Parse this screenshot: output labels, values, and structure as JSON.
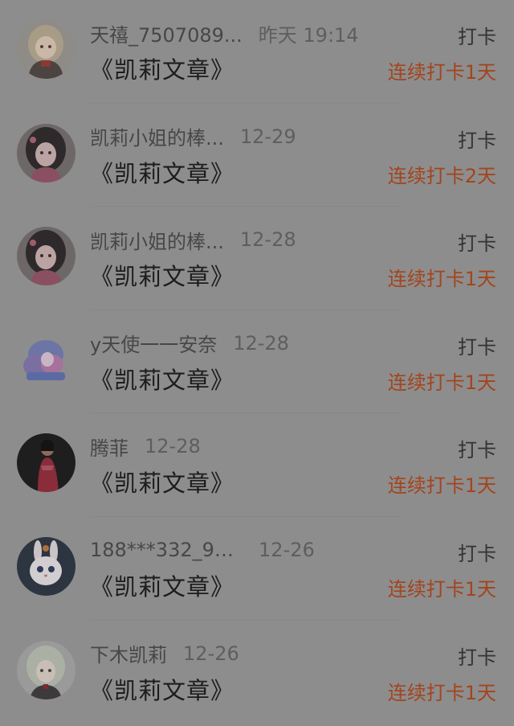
{
  "colors": {
    "overlay_background": "#8d8d8d",
    "streak_text": "#a3441d",
    "primary_text": "#1c1c1c",
    "secondary_text": "#474747"
  },
  "feed": {
    "items": [
      {
        "name": "天禧_7507089...",
        "time": "昨天 19:14",
        "post": "《凯莉文章》",
        "action": "打卡",
        "streak": "连续打卡1天",
        "avatar_icon": "anime-girl-cream-hair-avatar"
      },
      {
        "name": "凯莉小姐的棒...",
        "time": "12-29",
        "post": "《凯莉文章》",
        "action": "打卡",
        "streak": "连续打卡2天",
        "avatar_icon": "anime-girl-dark-hair-avatar"
      },
      {
        "name": "凯莉小姐的棒...",
        "time": "12-28",
        "post": "《凯莉文章》",
        "action": "打卡",
        "streak": "连续打卡1天",
        "avatar_icon": "anime-girl-dark-hair-avatar"
      },
      {
        "name": "y天使一一安奈",
        "time": "12-28",
        "post": "《凯莉文章》",
        "action": "打卡",
        "streak": "连续打卡1天",
        "avatar_icon": "anime-blue-hair-avatar"
      },
      {
        "name": "腾菲",
        "time": "12-28",
        "post": "《凯莉文章》",
        "action": "打卡",
        "streak": "连续打卡1天",
        "avatar_icon": "woman-red-dress-photo-avatar"
      },
      {
        "name": "188***332_92...",
        "time": "12-26",
        "post": "《凯莉文章》",
        "action": "打卡",
        "streak": "连续打卡1天",
        "avatar_icon": "white-rabbit-avatar"
      },
      {
        "name": "下木凯莉",
        "time": "12-26",
        "post": "《凯莉文章》",
        "action": "打卡",
        "streak": "连续打卡1天",
        "avatar_icon": "anime-girl-pale-green-hair-avatar"
      }
    ]
  }
}
